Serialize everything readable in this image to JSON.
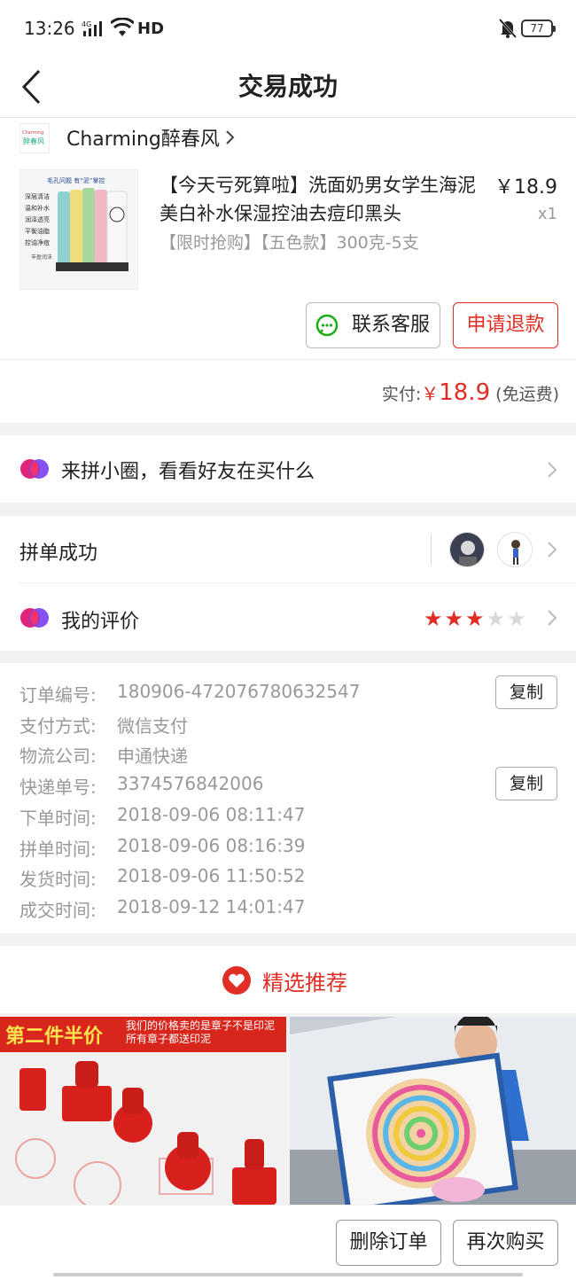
{
  "status_bar": {
    "time": "13:26",
    "network": "4G",
    "hd": "HD",
    "battery": "77"
  },
  "nav": {
    "title": "交易成功"
  },
  "shop": {
    "name": "Charming醉春风",
    "logo_text": "Charming",
    "logo_sub": "醉春风"
  },
  "product": {
    "title": "【今天亏死算啦】洗面奶男女学生海泥美白补水保湿控油去痘印黑头",
    "spec": "【限时抢购】【五色款】300克-5支",
    "price": "￥18.9",
    "qty": "x1",
    "image_header": "毛孔问题 有“泥”掌控",
    "image_lines": [
      "深层清洁",
      "温和补水",
      "润泽透亮",
      "平衡油脂",
      "控油净痘"
    ],
    "image_footer": "丰盈润沫"
  },
  "actions": {
    "contact": "联系客服",
    "refund": "申请退款"
  },
  "payment": {
    "label": "实付:",
    "currency": "￥",
    "amount": "18.9",
    "note": "(免运费)"
  },
  "circle": {
    "label": "来拼小圈，看看好友在买什么"
  },
  "group": {
    "label": "拼单成功"
  },
  "review": {
    "label": "我的评价",
    "rating": 3,
    "max": 5
  },
  "order_info": [
    {
      "label": "订单编号:",
      "value": "180906-472076780632547"
    },
    {
      "label": "支付方式:",
      "value": "微信支付"
    },
    {
      "label": "物流公司:",
      "value": "申通快递"
    },
    {
      "label": "快递单号:",
      "value": "3374576842006"
    },
    {
      "label": "下单时间:",
      "value": "2018-09-06 08:11:47"
    },
    {
      "label": "拼单时间:",
      "value": "2018-09-06 08:16:39"
    },
    {
      "label": "发货时间:",
      "value": "2018-09-06 11:50:52"
    },
    {
      "label": "成交时间:",
      "value": "2018-09-12 14:01:47"
    }
  ],
  "copy_label": "复制",
  "recommend": {
    "title": "精选推荐",
    "tile1_banner": "第二件半价",
    "tile1_sub": "我们的价格卖的是章子不是印泥 所有章子都送印泥"
  },
  "bottom": {
    "delete": "删除订单",
    "again": "再次购买"
  },
  "colors": {
    "accent": "#e02e24",
    "star_on": "#e02e24",
    "star_off": "#d8d8d8"
  }
}
